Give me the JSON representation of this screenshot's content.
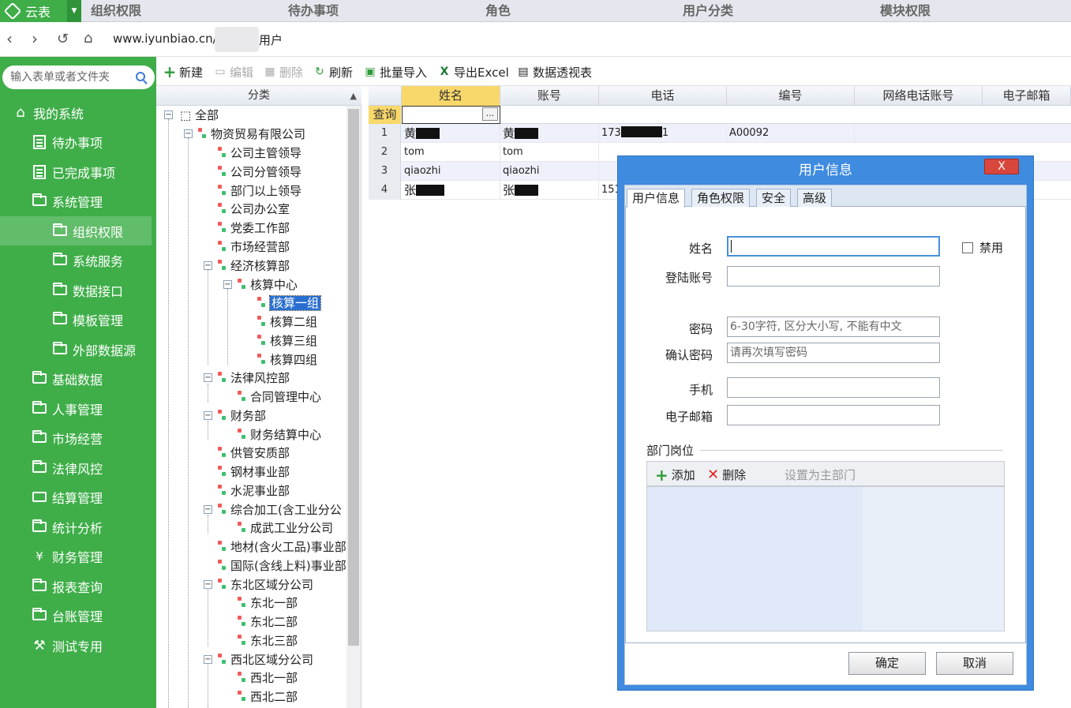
{
  "app": {
    "brand": "云表"
  },
  "top_tabs": [
    "组织权限",
    "待办事项",
    "角色",
    "用户分类",
    "模块权限"
  ],
  "address": {
    "url": "www.iyunbiao.cn/",
    "suffix": "用户"
  },
  "sidebar": {
    "search_placeholder": "输入表单或者文件夹",
    "items": [
      {
        "label": "我的系统",
        "icon": "home-icon"
      },
      {
        "label": "待办事项",
        "icon": "document-icon"
      },
      {
        "label": "已完成事项",
        "icon": "document-icon"
      },
      {
        "label": "系统管理",
        "icon": "folder-icon"
      },
      {
        "label": "组织权限",
        "icon": "folder-icon"
      },
      {
        "label": "系统服务",
        "icon": "folder-icon"
      },
      {
        "label": "数据接口",
        "icon": "folder-icon"
      },
      {
        "label": "模板管理",
        "icon": "folder-icon"
      },
      {
        "label": "外部数据源",
        "icon": "folder-icon"
      },
      {
        "label": "基础数据",
        "icon": "folder-icon"
      },
      {
        "label": "人事管理",
        "icon": "folder-icon"
      },
      {
        "label": "市场经营",
        "icon": "folder-icon"
      },
      {
        "label": "法律风控",
        "icon": "folder-icon"
      },
      {
        "label": "结算管理",
        "icon": "card-icon"
      },
      {
        "label": "统计分析",
        "icon": "folder-icon"
      },
      {
        "label": "财务管理",
        "icon": "finance-icon"
      },
      {
        "label": "报表查询",
        "icon": "folder-icon"
      },
      {
        "label": "台账管理",
        "icon": "folder-icon"
      },
      {
        "label": "测试专用",
        "icon": "tools-icon"
      }
    ]
  },
  "toolbar": {
    "new": "新建",
    "edit": "编辑",
    "delete": "删除",
    "refresh": "刷新",
    "import": "批量导入",
    "export": "导出Excel",
    "pivot": "数据透视表"
  },
  "tree": {
    "header": "分类",
    "nodes": [
      "全部",
      "物资贸易有限公司",
      "公司主管领导",
      "公司分管领导",
      "部门以上领导",
      "公司办公室",
      "党委工作部",
      "市场经营部",
      "经济核算部",
      "核算中心",
      "核算一组",
      "核算二组",
      "核算三组",
      "核算四组",
      "法律风控部",
      "合同管理中心",
      "财务部",
      "财务结算中心",
      "供管安质部",
      "钢材事业部",
      "水泥事业部",
      "综合加工(含工业分公",
      "成武工业分公司",
      "地材(含火工品)事业部",
      "国际(含线上料)事业部",
      "东北区域分公司",
      "东北一部",
      "东北二部",
      "东北三部",
      "西北区域分公司",
      "西北一部",
      "西北二部"
    ]
  },
  "grid": {
    "columns": [
      "姓名",
      "账号",
      "电话",
      "编号",
      "网络电话账号",
      "电子邮箱"
    ],
    "query_label": "查询",
    "query_button": "...",
    "rows": [
      {
        "num": "1",
        "name": "黄",
        "account": "黄",
        "phone_prefix": "173",
        "phone_suffix": "1",
        "code": "A00092"
      },
      {
        "num": "2",
        "name": "tom",
        "account": "tom",
        "phone_prefix": "",
        "phone_suffix": "",
        "code": ""
      },
      {
        "num": "3",
        "name": "qiaozhi",
        "account": "qiaozhi",
        "phone_prefix": "",
        "phone_suffix": "",
        "code": ""
      },
      {
        "num": "4",
        "name": "张",
        "account": "张",
        "phone_prefix": "151",
        "phone_suffix": "",
        "code": ""
      }
    ]
  },
  "dialog": {
    "title": "用户信息",
    "close": "X",
    "tabs": [
      "用户信息",
      "角色权限",
      "安全",
      "高级"
    ],
    "fields": {
      "name_label": "姓名",
      "login_label": "登陆账号",
      "password_label": "密码",
      "password_placeholder": "6-30字符, 区分大小写, 不能有中文",
      "confirm_label": "确认密码",
      "confirm_placeholder": "请再次填写密码",
      "mobile_label": "手机",
      "email_label": "电子邮箱",
      "disable_label": "禁用"
    },
    "section": "部门岗位",
    "sub_toolbar": {
      "add": "添加",
      "delete": "删除",
      "set_main": "设置为主部门"
    },
    "ok": "确定",
    "cancel": "取消"
  }
}
